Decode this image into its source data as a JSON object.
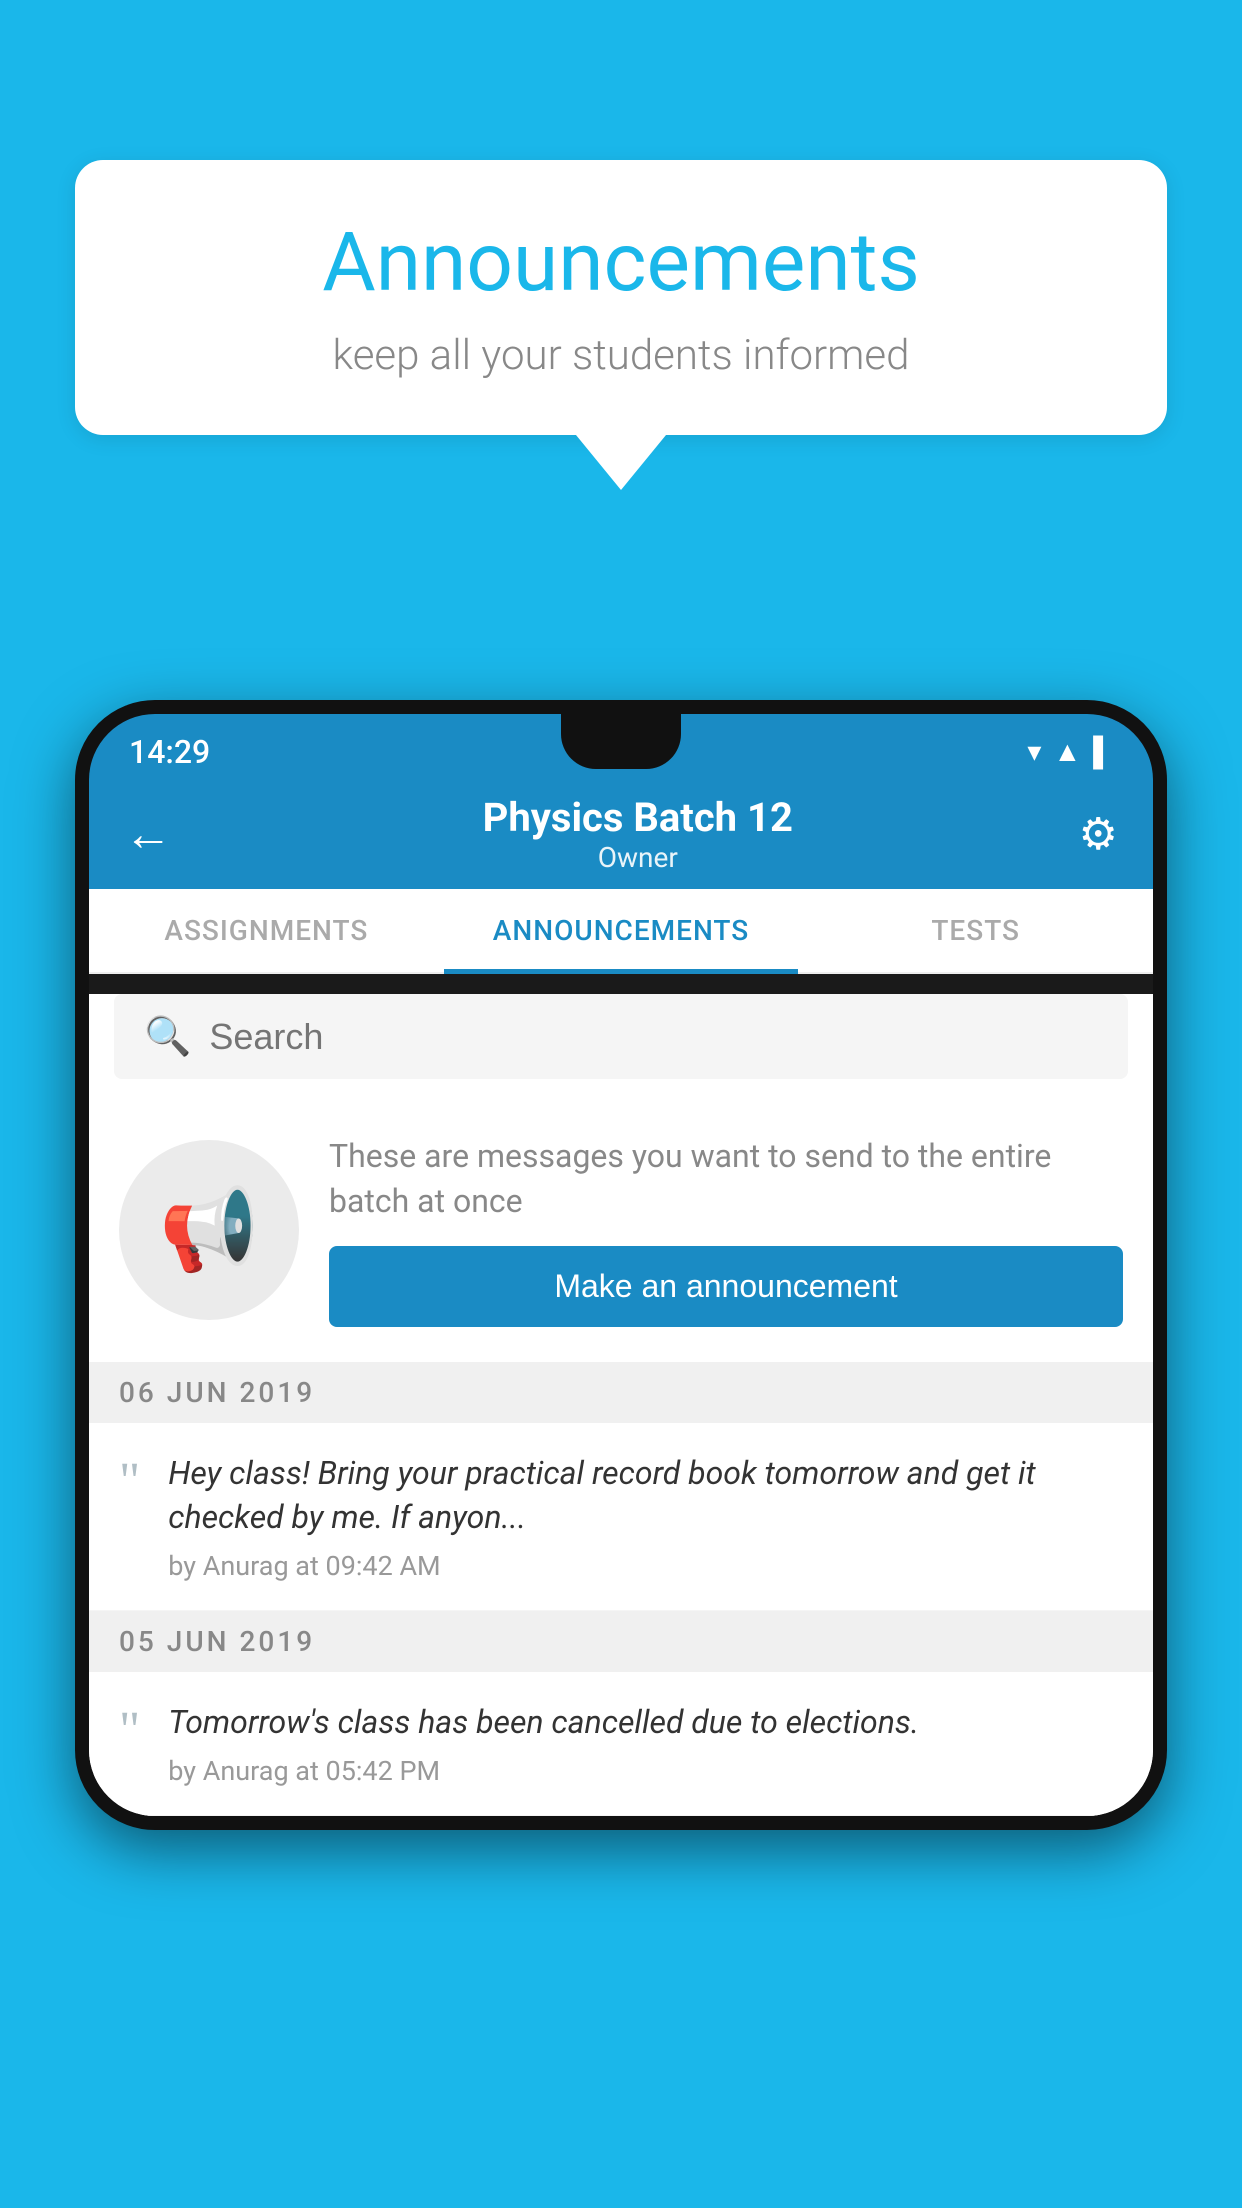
{
  "bubble": {
    "title": "Announcements",
    "subtitle": "keep all your students informed"
  },
  "phone": {
    "statusBar": {
      "time": "14:29"
    },
    "appBar": {
      "title": "Physics Batch 12",
      "subtitle": "Owner"
    },
    "tabs": [
      {
        "label": "ASSIGNMENTS",
        "active": false
      },
      {
        "label": "ANNOUNCEMENTS",
        "active": true
      },
      {
        "label": "TESTS",
        "active": false
      }
    ],
    "search": {
      "placeholder": "Search"
    },
    "emptyState": {
      "description": "These are messages you want to send to the entire batch at once",
      "buttonLabel": "Make an announcement"
    },
    "announcements": [
      {
        "date": "06  JUN  2019",
        "message": "Hey class! Bring your practical record book tomorrow and get it checked by me. If anyon...",
        "meta": "by Anurag at 09:42 AM"
      },
      {
        "date": "05  JUN  2019",
        "message": "Tomorrow's class has been cancelled due to elections.",
        "meta": "by Anurag at 05:42 PM"
      }
    ]
  }
}
